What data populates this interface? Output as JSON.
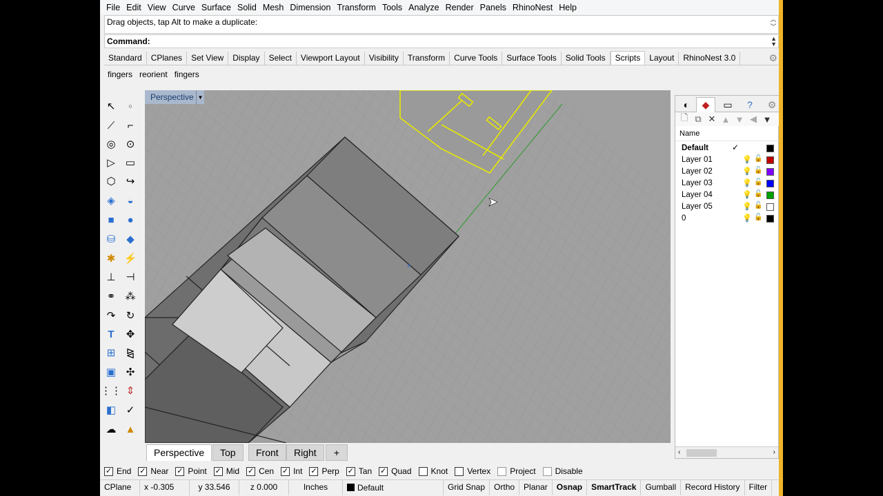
{
  "menu": [
    "File",
    "Edit",
    "View",
    "Curve",
    "Surface",
    "Solid",
    "Mesh",
    "Dimension",
    "Transform",
    "Tools",
    "Analyze",
    "Render",
    "Panels",
    "RhinoNest",
    "Help"
  ],
  "command": {
    "history": "Drag objects, tap Alt to make a duplicate:",
    "prompt": "Command:"
  },
  "tabs": [
    "Standard",
    "CPlanes",
    "Set View",
    "Display",
    "Select",
    "Viewport Layout",
    "Visibility",
    "Transform",
    "Curve Tools",
    "Surface Tools",
    "Solid Tools",
    "Scripts",
    "Layout",
    "RhinoNest 3.0"
  ],
  "active_tab": "Scripts",
  "scripts": [
    "fingers",
    "reorient",
    "fingers"
  ],
  "viewport": {
    "label": "Perspective",
    "tabs": [
      "Perspective",
      "Top",
      "Front",
      "Right"
    ],
    "add_tab": "+"
  },
  "layers": {
    "header": "Name",
    "rows": [
      {
        "name": "Default",
        "current": "✓",
        "color": "#000000",
        "bold": true
      },
      {
        "name": "Layer 01",
        "current": "",
        "color": "#c00000"
      },
      {
        "name": "Layer 02",
        "current": "",
        "color": "#7f00ff"
      },
      {
        "name": "Layer 03",
        "current": "",
        "color": "#0000ff"
      },
      {
        "name": "Layer 04",
        "current": "",
        "color": "#00a000"
      },
      {
        "name": "Layer 05",
        "current": "",
        "color": "#ffffff"
      },
      {
        "name": "0",
        "current": "",
        "color": "#000000"
      }
    ]
  },
  "osnaps": [
    {
      "label": "End",
      "checked": true
    },
    {
      "label": "Near",
      "checked": true
    },
    {
      "label": "Point",
      "checked": true
    },
    {
      "label": "Mid",
      "checked": true
    },
    {
      "label": "Cen",
      "checked": true
    },
    {
      "label": "Int",
      "checked": true
    },
    {
      "label": "Perp",
      "checked": true
    },
    {
      "label": "Tan",
      "checked": true
    },
    {
      "label": "Quad",
      "checked": true
    },
    {
      "label": "Knot",
      "checked": false
    },
    {
      "label": "Vertex",
      "checked": false
    },
    {
      "label": "Project",
      "checked": false
    },
    {
      "label": "Disable",
      "checked": false
    }
  ],
  "status": {
    "cplane": "CPlane",
    "x": "x -0.305",
    "y": "y 33.546",
    "z": "z 0.000",
    "units": "Inches",
    "layer": "Default",
    "toggles": [
      "Grid Snap",
      "Ortho",
      "Planar",
      "Osnap",
      "SmartTrack",
      "Gumball",
      "Record History",
      "Filter"
    ],
    "bold_toggles": [
      "Osnap",
      "SmartTrack"
    ]
  }
}
